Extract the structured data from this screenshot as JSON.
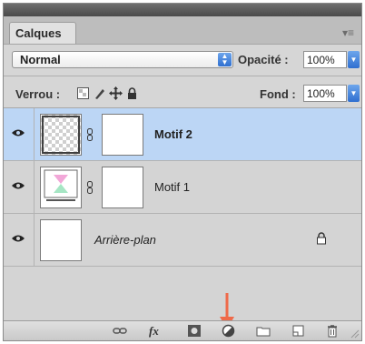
{
  "panel": {
    "tab_label": "Calques",
    "menu_icon": "panel-menu-icon"
  },
  "blend": {
    "mode": "Normal",
    "opacity_label": "Opacité :",
    "opacity_value": "100%"
  },
  "lock": {
    "label": "Verrou :",
    "buttons": [
      "lock-transparent-pixels-icon",
      "lock-image-pixels-icon",
      "lock-position-icon",
      "lock-all-icon"
    ],
    "fill_label": "Fond :",
    "fill_value": "100%"
  },
  "layers": [
    {
      "name": "Motif 2",
      "selected": true,
      "visible": true
    },
    {
      "name": "Motif 1",
      "selected": false,
      "visible": true
    },
    {
      "name": "Arrière-plan",
      "selected": false,
      "visible": true,
      "locked": true
    }
  ],
  "footer": {
    "buttons": [
      "link-layers-icon",
      "layer-style-icon",
      "layer-mask-icon",
      "adjustment-layer-icon",
      "new-group-icon",
      "new-layer-icon",
      "delete-layer-icon"
    ],
    "fx_label": "fx"
  },
  "colors": {
    "selection": "#bcd6f5",
    "accent_arrow": "#ef6a4a",
    "stepper_blue": "#3f80dd"
  }
}
